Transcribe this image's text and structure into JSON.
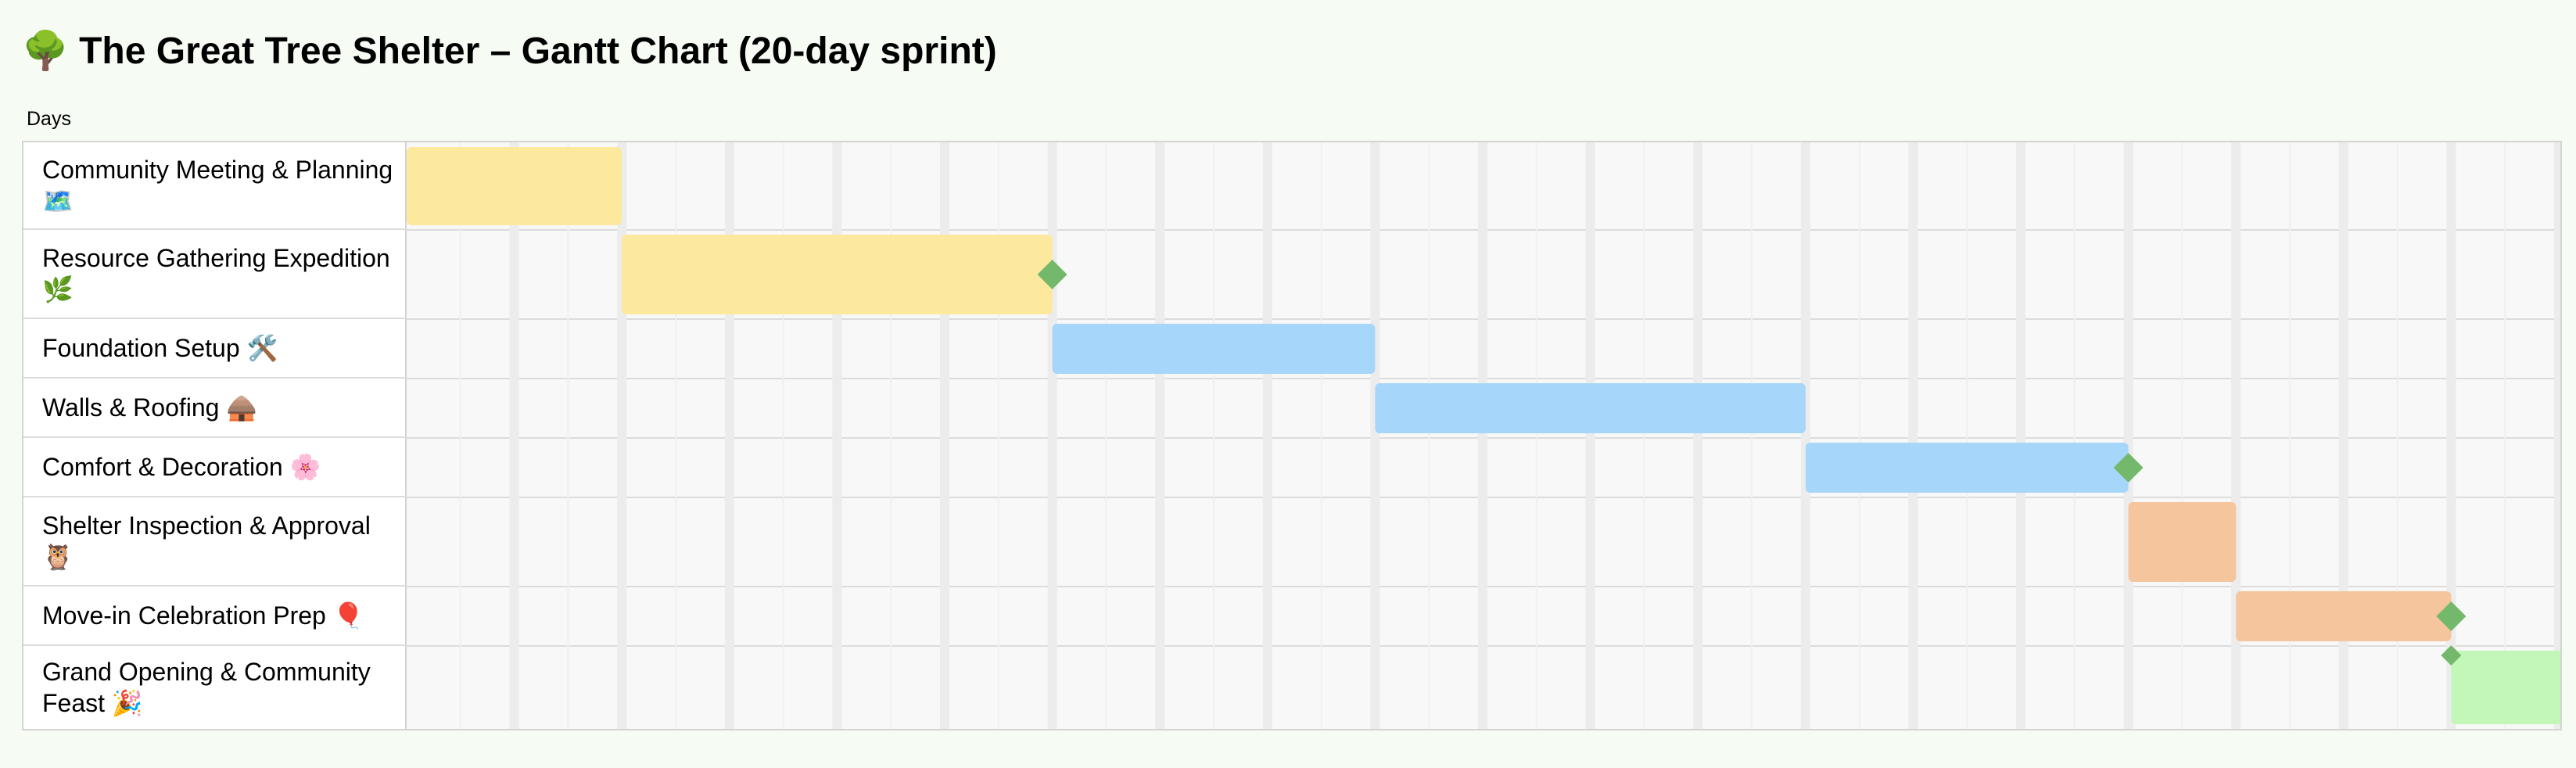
{
  "title": "🌳 The Great Tree Shelter – Gantt Chart (20-day sprint)",
  "axis_label": "Days",
  "colors": {
    "yellow": "#fde99e",
    "blue": "#a6d6fa",
    "orange": "#f5c59d",
    "green": "#c3f7b8",
    "milestone": "#74b96b",
    "gridline": "#ececec"
  },
  "chart_data": {
    "type": "gantt",
    "title": "🌳 The Great Tree Shelter – Gantt Chart (20-day sprint)",
    "xlabel": "Days",
    "xlim": [
      0,
      20
    ],
    "grid": true,
    "tasks": [
      {
        "name": "Community Meeting & Planning 🗺️",
        "start": 0,
        "end": 2,
        "color": "#fde99e",
        "milestone_end": false,
        "milestone_start": false
      },
      {
        "name": "Resource Gathering Expedition 🌿",
        "start": 2,
        "end": 6,
        "color": "#fde99e",
        "milestone_end": true,
        "milestone_start": false
      },
      {
        "name": "Foundation Setup 🛠️",
        "start": 6,
        "end": 9,
        "color": "#a6d6fa",
        "milestone_end": false,
        "milestone_start": false
      },
      {
        "name": "Walls & Roofing 🛖",
        "start": 9,
        "end": 13,
        "color": "#a6d6fa",
        "milestone_end": false,
        "milestone_start": false
      },
      {
        "name": "Comfort & Decoration 🌸",
        "start": 13,
        "end": 16,
        "color": "#a6d6fa",
        "milestone_end": true,
        "milestone_start": false
      },
      {
        "name": "Shelter Inspection & Approval 🦉",
        "start": 16,
        "end": 17,
        "color": "#f5c59d",
        "milestone_end": false,
        "milestone_start": false
      },
      {
        "name": "Move-in Celebration Prep 🎈",
        "start": 17,
        "end": 19,
        "color": "#f5c59d",
        "milestone_end": true,
        "milestone_start": false
      },
      {
        "name": "Grand Opening & Community Feast 🎉",
        "start": 19,
        "end": 20.2,
        "color": "#c3f7b8",
        "milestone_end": false,
        "milestone_start": true
      }
    ]
  }
}
